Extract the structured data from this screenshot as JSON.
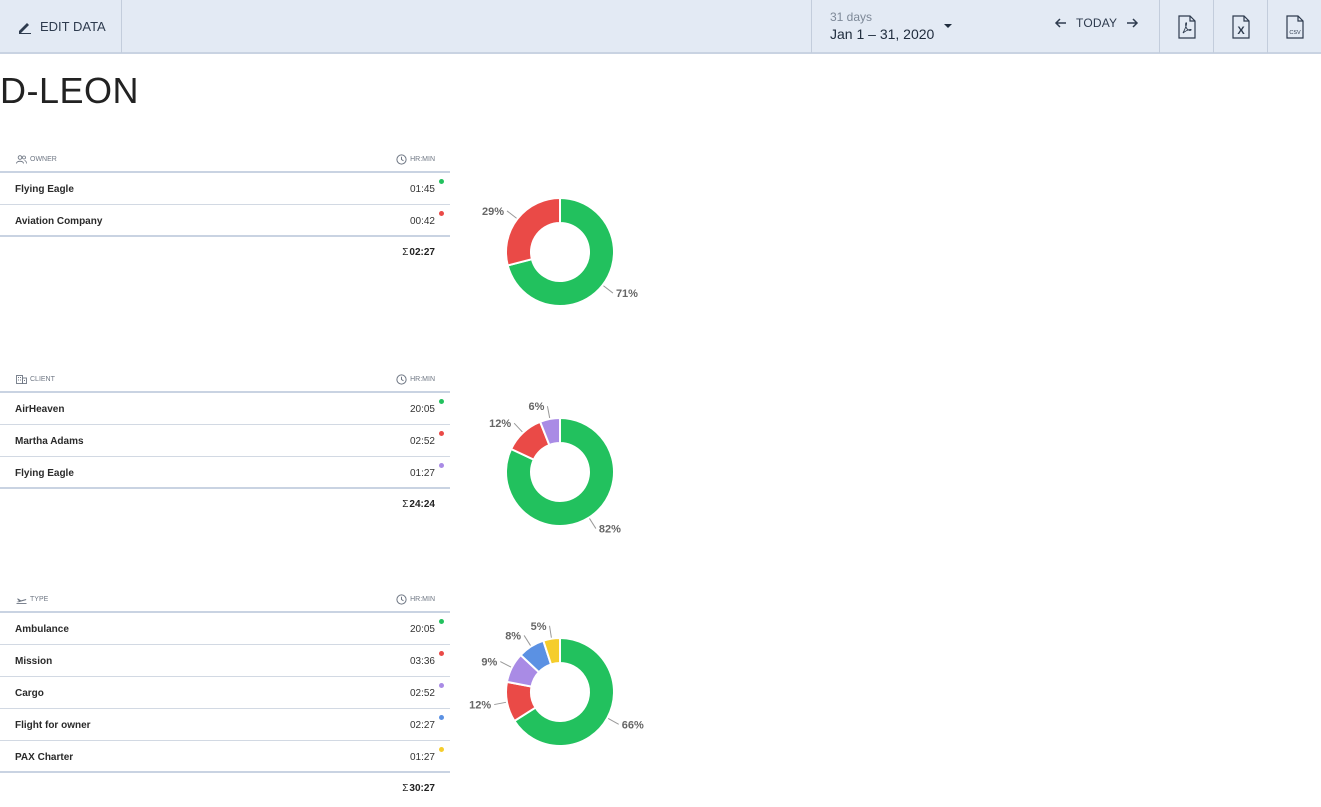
{
  "toolbar": {
    "edit_label": "EDIT DATA",
    "date_sub": "31 days",
    "date_range": "Jan 1 – 31, 2020",
    "today_label": "TODAY",
    "exports": [
      {
        "icon": "pdf-icon",
        "label": "PDF"
      },
      {
        "icon": "xls-icon",
        "label": "X"
      },
      {
        "icon": "csv-icon",
        "label": "CSV"
      }
    ]
  },
  "title": "D-LEON",
  "unit_label": "HR:MIN",
  "colors": {
    "green": "#22c15e",
    "red": "#ea4a47",
    "purple": "#a98be5",
    "blue": "#5b91e3",
    "yellow": "#f5cd2c",
    "header_bg": "#e3eaf4"
  },
  "sections": [
    {
      "header": "OWNER",
      "icon": "people-icon",
      "rows": [
        {
          "name": "Flying Eagle",
          "value": "01:45",
          "color": "#22c15e"
        },
        {
          "name": "Aviation Company",
          "value": "00:42",
          "color": "#ea4a47"
        }
      ],
      "total": "02:27"
    },
    {
      "header": "CLIENT",
      "icon": "building-icon",
      "rows": [
        {
          "name": "AirHeaven",
          "value": "20:05",
          "color": "#22c15e"
        },
        {
          "name": "Martha Adams",
          "value": "02:52",
          "color": "#ea4a47"
        },
        {
          "name": "Flying Eagle",
          "value": "01:27",
          "color": "#a98be5"
        }
      ],
      "total": "24:24"
    },
    {
      "header": "TYPE",
      "icon": "plane-takeoff-icon",
      "rows": [
        {
          "name": "Ambulance",
          "value": "20:05",
          "color": "#22c15e"
        },
        {
          "name": "Mission",
          "value": "03:36",
          "color": "#ea4a47"
        },
        {
          "name": "Cargo",
          "value": "02:52",
          "color": "#a98be5"
        },
        {
          "name": "Flight for owner",
          "value": "02:27",
          "color": "#5b91e3"
        },
        {
          "name": "PAX Charter",
          "value": "01:27",
          "color": "#f5cd2c"
        }
      ],
      "total": "30:27"
    }
  ],
  "chart_data": [
    {
      "type": "pie",
      "categories": [
        "Flying Eagle",
        "Aviation Company"
      ],
      "values": [
        71,
        29
      ],
      "labels": [
        "71%",
        "29%"
      ],
      "colors": [
        "#22c15e",
        "#ea4a47"
      ]
    },
    {
      "type": "pie",
      "categories": [
        "AirHeaven",
        "Martha Adams",
        "Flying Eagle"
      ],
      "values": [
        82,
        12,
        6
      ],
      "labels": [
        "82%",
        "12%",
        "6%"
      ],
      "colors": [
        "#22c15e",
        "#ea4a47",
        "#a98be5"
      ]
    },
    {
      "type": "pie",
      "categories": [
        "Ambulance",
        "Mission",
        "Cargo",
        "Flight for owner",
        "PAX Charter"
      ],
      "values": [
        66,
        12,
        9,
        8,
        5
      ],
      "labels": [
        "66%",
        "12%",
        "9%",
        "8%",
        "5%"
      ],
      "colors": [
        "#22c15e",
        "#ea4a47",
        "#a98be5",
        "#5b91e3",
        "#f5cd2c"
      ]
    }
  ]
}
